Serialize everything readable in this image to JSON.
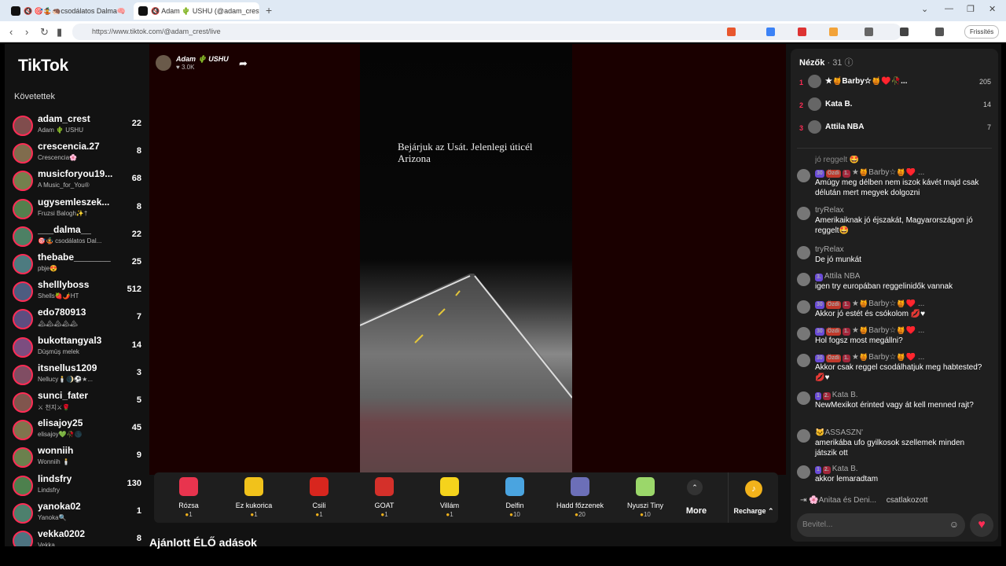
{
  "browser": {
    "tabs": [
      {
        "label": "🔇 🎯🤹🦔csodálatos Dalma🧠 ..."
      },
      {
        "label": "🔇 Adam 🌵 USHU (@adam_crest..."
      }
    ],
    "url": "https://www.tiktok.com/@adam_crest/live",
    "update_label": "Frissítés"
  },
  "sidebar": {
    "logo": "TikTok",
    "following_heading": "Követettek",
    "accounts": [
      {
        "name": "adam_crest",
        "sub": "Adam 🌵 USHU",
        "count": "22"
      },
      {
        "name": "crescencia.27",
        "sub": "Crescencia🌸",
        "count": "8"
      },
      {
        "name": "musicforyou19...",
        "sub": "A Music_for_You®",
        "count": "68"
      },
      {
        "name": "ugysemleszek...",
        "sub": "Fruzsi Balogh✨†",
        "count": "8"
      },
      {
        "name": "___dalma__",
        "sub": "🎯🤹 csodálatos Dal...",
        "count": "22"
      },
      {
        "name": "thebabe_______",
        "sub": "pbje😍",
        "count": "25"
      },
      {
        "name": "shelllyboss",
        "sub": "Shells🍓🌶️HT",
        "count": "512"
      },
      {
        "name": "edo780913",
        "sub": "🏔🏔🏔🏔🏔",
        "count": "7"
      },
      {
        "name": "bukottangyal3",
        "sub": "Düşmüş melek",
        "count": "14"
      },
      {
        "name": "itsnellus1209",
        "sub": "Nellucy🕯️🌒⚽★...",
        "count": "3"
      },
      {
        "name": "sunci_fater",
        "sub": "⚔ 천지⚔🌹",
        "count": "5"
      },
      {
        "name": "elisajoy25",
        "sub": "elisajoy💚🥀🌑",
        "count": "45"
      },
      {
        "name": "wonniih",
        "sub": "Wonniih 🕯️",
        "count": "9"
      },
      {
        "name": "lindsfry",
        "sub": "Lindsfry",
        "count": "130"
      },
      {
        "name": "yanoka02",
        "sub": "Yanoka🔍",
        "count": "1"
      },
      {
        "name": "vekka0202",
        "sub": "Vekka",
        "count": "8"
      }
    ]
  },
  "stream": {
    "streamer_name": "Adam 🌵 USHU",
    "likes": "♥ 3.0K",
    "caption": "Bejárjuk az Usát. Jelenlegi úticél Arizona"
  },
  "gifts": [
    {
      "name": "Rózsa",
      "price": "1",
      "color": "#e8344e"
    },
    {
      "name": "Ez kukorica",
      "price": "1",
      "color": "#f1c21b"
    },
    {
      "name": "Csili",
      "price": "1",
      "color": "#d8261e"
    },
    {
      "name": "GOAT",
      "price": "1",
      "color": "#d4302a"
    },
    {
      "name": "Villám",
      "price": "1",
      "color": "#f5d31c"
    },
    {
      "name": "Delfin",
      "price": "10",
      "color": "#4aa4e0"
    },
    {
      "name": "Hadd főzzenek",
      "price": "20",
      "color": "#6c6fb8"
    },
    {
      "name": "Nyuszi Tiny",
      "price": "10",
      "color": "#9bd76a"
    }
  ],
  "more_label": "More",
  "recharge_label": "Recharge ⌃",
  "recommended_heading": "Ajánlott ÉLŐ adások",
  "chat": {
    "viewers_label": "Nézők",
    "viewers_count": "· 31",
    "top_viewers": [
      {
        "rank": "1",
        "name": "★🍯Barby☆🍯♥️🥀...",
        "score": "205"
      },
      {
        "rank": "2",
        "name": "Kata B.",
        "score": "14"
      },
      {
        "rank": "3",
        "name": "Attila NBA",
        "score": "7"
      }
    ],
    "partial_message": "jó reggelt 🤩",
    "messages": [
      {
        "user": "★🍯Barby☆🍯♥️ ...",
        "badges": [
          "30",
          "Özdi",
          "1."
        ],
        "text": "Amúgy meg délben nem iszok kávét majd csak délután mert megyek dolgozni"
      },
      {
        "user": "tryRelax",
        "badges": [],
        "text": "Amerikaiknak jó éjszakát, Magyarországon jó reggelt🤩"
      },
      {
        "user": "tryRelax",
        "badges": [],
        "text": "De jó munkát"
      },
      {
        "user": "Attila NBA",
        "badges": [
          "3."
        ],
        "text": "igen try europában reggelinidők vannak"
      },
      {
        "user": "★🍯Barby☆🍯♥️ ...",
        "badges": [
          "30",
          "Özdi",
          "1."
        ],
        "text": "Akkor jó estét és csókolom 💋♥"
      },
      {
        "user": "★🍯Barby☆🍯♥️ ...",
        "badges": [
          "30",
          "Özdi",
          "1."
        ],
        "text": "Hol fogsz most megállni?"
      },
      {
        "user": "★🍯Barby☆🍯♥️ ...",
        "badges": [
          "30",
          "Özdi",
          "1."
        ],
        "text": "Akkor csak reggel csodálhatjuk meg habtested? 💋♥"
      },
      {
        "user": "Kata B.",
        "badges": [
          "1",
          "2."
        ],
        "text": "NewMexikot érinted vagy át kell menned rajt?"
      },
      {
        "user": "🐱ASSASZN'",
        "badges": [],
        "text": "amerikába ufo gyilkosok szellemek minden játszik ott"
      },
      {
        "user": "Kata B.",
        "badges": [
          "1",
          "2."
        ],
        "text": "akkor lemaradtam"
      }
    ],
    "join_user": "🌸Anitaa és Deni...",
    "join_text": "csatlakozott",
    "input_placeholder": "Bevitel..."
  }
}
